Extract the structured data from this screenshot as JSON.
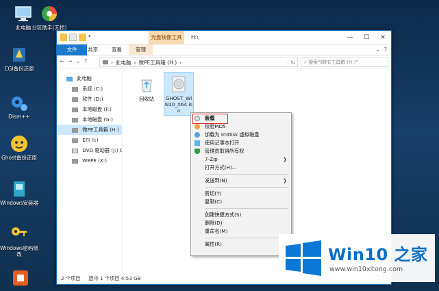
{
  "desktop": {
    "icons": [
      {
        "label": "此电脑",
        "icon": "computer-icon"
      },
      {
        "label": "分区助手(无损)",
        "icon": "partition-tool-icon"
      },
      {
        "label": "CGI备份还原",
        "icon": "cgi-backup-icon"
      },
      {
        "label": "Dism++",
        "icon": "dism-icon"
      },
      {
        "label": "Ghost备份还原",
        "icon": "ghost-backup-icon"
      },
      {
        "label": "Windows安装器",
        "icon": "windows-installer-icon"
      },
      {
        "label": "Windows密码修改",
        "icon": "password-key-icon"
      },
      {
        "label": "",
        "icon": "app-icon"
      }
    ]
  },
  "window": {
    "context_tab": "光盘映像工具",
    "title": "H:\\",
    "controls": [
      "—",
      "☐",
      "✕"
    ],
    "ribbon_tabs": [
      "文件",
      "主页",
      "共享",
      "查看",
      "管理"
    ],
    "address": {
      "segments": [
        "此电脑",
        "微PE工具箱 (H:)"
      ]
    },
    "search_placeholder": "搜索\"微PE工具箱 (H:)\"",
    "nav": [
      {
        "label": "此电脑",
        "icon": "computer-icon"
      },
      {
        "label": "系统 (C:)",
        "icon": "drive-icon"
      },
      {
        "label": "软件 (D:)",
        "icon": "drive-icon"
      },
      {
        "label": "本地磁盘 (F:)",
        "icon": "drive-icon"
      },
      {
        "label": "本地磁盘 (G:)",
        "icon": "drive-icon"
      },
      {
        "label": "微PE工具箱 (H:)",
        "icon": "drive-icon",
        "selected": true
      },
      {
        "label": "EFI (I:)",
        "icon": "drive-icon"
      },
      {
        "label": "DVD 驱动器 (J:) GH",
        "icon": "dvd-icon"
      },
      {
        "label": "WEPE (X:)",
        "icon": "drive-icon"
      }
    ],
    "files": [
      {
        "name": "回收站",
        "icon": "recycle-bin-icon"
      },
      {
        "name": "GHOST_WIN10_X64.iso",
        "icon": "disc-image-icon",
        "selected": true
      }
    ],
    "status": {
      "count": "2 个项目",
      "selected": "选中 1 个项目  4.53 GB"
    }
  },
  "context_menu": {
    "items": [
      {
        "label": "装载",
        "icon": "disc-icon",
        "highlight": true
      },
      {
        "label": "校验MD5",
        "icon": "md5-icon"
      },
      {
        "label": "加载为 ImDisk 虚拟磁盘",
        "icon": "imdisk-icon"
      },
      {
        "label": "使用记事本打开",
        "icon": "notepad-icon"
      },
      {
        "label": "管理员取得所有权",
        "icon": "shield-icon"
      },
      {
        "label": "7-Zip",
        "submenu": true
      },
      {
        "label": "打开方式(H)..."
      },
      {
        "separator": true
      },
      {
        "label": "发送到(N)",
        "submenu": true
      },
      {
        "separator": true
      },
      {
        "label": "剪切(T)"
      },
      {
        "label": "复制(C)"
      },
      {
        "separator": true
      },
      {
        "label": "创建快捷方式(S)"
      },
      {
        "label": "删除(D)"
      },
      {
        "label": "重命名(M)"
      },
      {
        "separator": true
      },
      {
        "label": "属性(R)"
      }
    ]
  },
  "brand": {
    "title": "Win10 之家",
    "url": "www.win10xitong.com"
  },
  "colors": {
    "accent": "#1979ca",
    "context_tab": "#f9d9b0",
    "highlight_box": "#e0302a",
    "brand_blue": "#0a6ec8"
  }
}
